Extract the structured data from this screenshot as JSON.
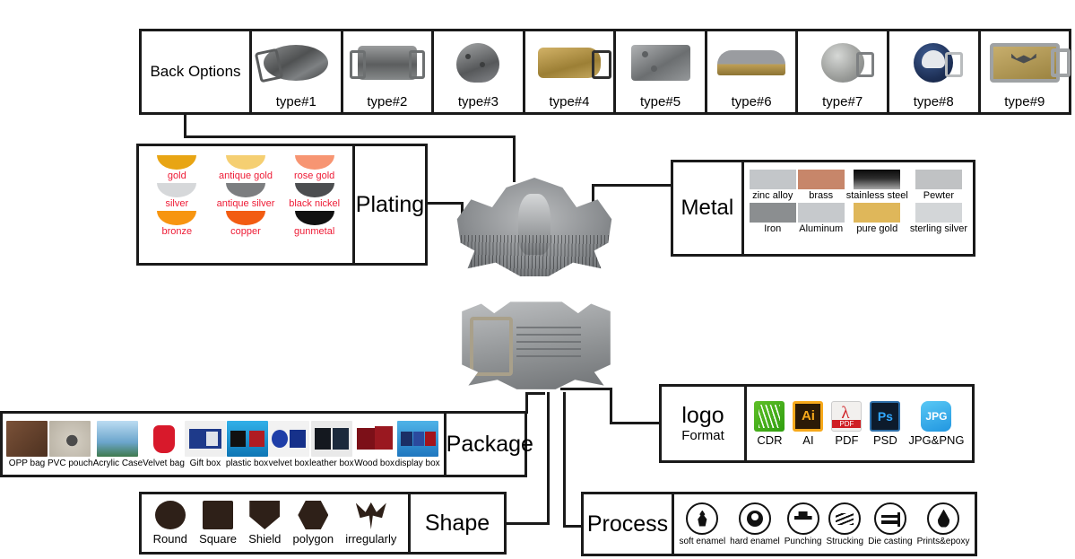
{
  "back_options": {
    "caption": "Back Options",
    "items": [
      {
        "label": "type#1",
        "icon": "buckle-oval-back-icon"
      },
      {
        "label": "type#2",
        "icon": "buckle-engraved-back-icon"
      },
      {
        "label": "type#3",
        "icon": "buckle-rounded-back-icon"
      },
      {
        "label": "type#4",
        "icon": "buckle-gold-hook-back-icon"
      },
      {
        "label": "type#5",
        "icon": "buckle-rectangular-back-icon"
      },
      {
        "label": "type#6",
        "icon": "buckle-two-tone-back-icon"
      },
      {
        "label": "type#7",
        "icon": "buckle-star-round-back-icon"
      },
      {
        "label": "type#8",
        "icon": "buckle-berlin-bear-back-icon"
      },
      {
        "label": "type#9",
        "icon": "buckle-bat-rect-back-icon"
      }
    ]
  },
  "plating": {
    "caption": "Plating",
    "label_color": "#ee1b35",
    "items": [
      {
        "label": "gold",
        "color": "#e8a514"
      },
      {
        "label": "antique gold",
        "color": "#f5cf72"
      },
      {
        "label": "rose gold",
        "color": "#f79572"
      },
      {
        "label": "silver",
        "color": "#d6d8da"
      },
      {
        "label": "antique silver",
        "color": "#7c7e80"
      },
      {
        "label": "black nickel",
        "color": "#4c4e50"
      },
      {
        "label": "bronze",
        "color": "#f79510"
      },
      {
        "label": "copper",
        "color": "#f25c12"
      },
      {
        "label": "gunmetal",
        "color": "#111111"
      }
    ]
  },
  "metal": {
    "caption": "Metal",
    "items": [
      {
        "label": "zinc alloy",
        "color": "#c3c6c9"
      },
      {
        "label": "brass",
        "color": "#c7866a"
      },
      {
        "label": "stainless steel",
        "color": "#2b2b2b"
      },
      {
        "label": "Pewter",
        "color": "#c0c2c4"
      },
      {
        "label": "Iron",
        "color": "#8b8e90"
      },
      {
        "label": "Aluminum",
        "color": "#c6c9cc"
      },
      {
        "label": "pure gold",
        "color": "#dfb košice"
      },
      {
        "label": "sterling silver",
        "color": "#d3d6d8"
      }
    ]
  },
  "logo_format": {
    "caption_line1": "logo",
    "caption_line2": "Format",
    "items": [
      {
        "label": "CDR",
        "icon": "coreldraw-icon"
      },
      {
        "label": "AI",
        "icon": "illustrator-icon",
        "glyph": "Ai"
      },
      {
        "label": "PDF",
        "icon": "pdf-icon",
        "glyph": "PDF"
      },
      {
        "label": "PSD",
        "icon": "photoshop-icon",
        "glyph": "Ps"
      },
      {
        "label": "JPG&PNG",
        "icon": "jpg-icon",
        "glyph": "JPG"
      }
    ]
  },
  "package": {
    "caption": "Package",
    "items": [
      {
        "label": "OPP bag",
        "color": "#6d4a35"
      },
      {
        "label": "PVC pouch",
        "color": "#b9b2a6"
      },
      {
        "label": "Acrylic Case",
        "color": "#7fb4d8"
      },
      {
        "label": "Velvet bag",
        "color": "#ffffff"
      },
      {
        "label": "Gift box",
        "color": "#e9e9e9"
      },
      {
        "label": "plastic box",
        "color": "#29a7de"
      },
      {
        "label": "velvet box",
        "color": "#efefef"
      },
      {
        "label": "leather box",
        "color": "#1f2630"
      },
      {
        "label": "Wood box",
        "color": "#ffffff"
      },
      {
        "label": "display box",
        "color": "#3aa0e0"
      }
    ]
  },
  "shape": {
    "caption": "Shape",
    "items": [
      {
        "label": "Round",
        "icon": "round-shape-icon"
      },
      {
        "label": "Square",
        "icon": "square-shape-icon"
      },
      {
        "label": "Shield",
        "icon": "shield-shape-icon"
      },
      {
        "label": "polygon",
        "icon": "polygon-shape-icon"
      },
      {
        "label": "irregularly",
        "icon": "butterfly-shape-icon"
      }
    ]
  },
  "process": {
    "caption": "Process",
    "items": [
      {
        "label": "soft enamel",
        "icon": "flame-icon"
      },
      {
        "label": "hard enamel",
        "icon": "filled-dot-icon"
      },
      {
        "label": "Punching",
        "icon": "press-machine-icon"
      },
      {
        "label": "Strucking",
        "icon": "striking-lines-icon"
      },
      {
        "label": "Die casting",
        "icon": "die-cast-icon"
      },
      {
        "label": "Prints&epoxy",
        "icon": "droplet-icon"
      }
    ]
  },
  "product": {
    "front_alt": "belt-buckle-front-view",
    "back_alt": "belt-buckle-back-view"
  }
}
